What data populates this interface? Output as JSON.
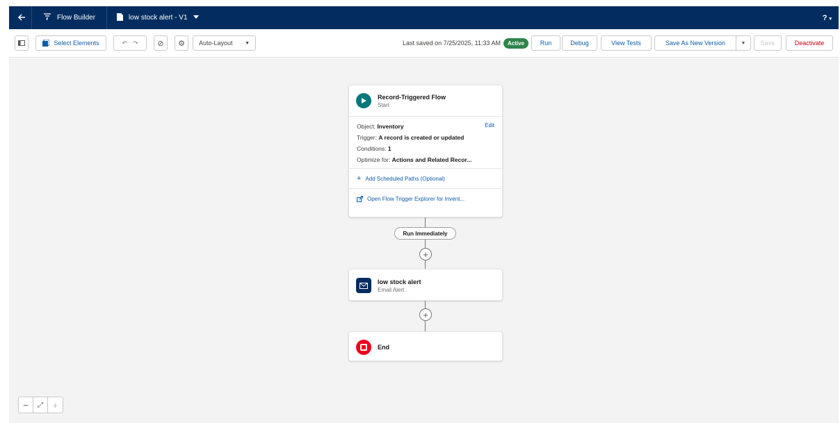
{
  "topbar": {
    "app_name": "Flow Builder",
    "file_name": "low stock alert - V1",
    "help_label": "?"
  },
  "toolbar": {
    "select_elements": "Select Elements",
    "layout_select": "Auto-Layout",
    "last_saved": "Last saved on 7/25/2025, 11:33 AM",
    "status_badge": "Active",
    "run": "Run",
    "debug": "Debug",
    "view_tests": "View Tests",
    "save_as_new_version": "Save As New Version",
    "save": "Save",
    "deactivate": "Deactivate"
  },
  "start_node": {
    "title": "Record-Triggered Flow",
    "subtitle": "Start",
    "edit": "Edit",
    "object_label": "Object:",
    "object_value": "Inventory",
    "trigger_label": "Trigger:",
    "trigger_value": "A record is created or updated",
    "conditions_label": "Conditions:",
    "conditions_value": "1",
    "optimize_label": "Optimize for:",
    "optimize_value": "Actions and Related Recor...",
    "add_scheduled_paths": "Add Scheduled Paths (Optional)",
    "open_trigger_explorer": "Open Flow Trigger Explorer for Invent..."
  },
  "path_label": "Run Immediately",
  "email_node": {
    "title": "low stock alert",
    "subtitle": "Email Alert"
  },
  "end_node": {
    "title": "End"
  },
  "colors": {
    "nav_bg": "#032d60",
    "canvas_bg": "#f3f3f3",
    "start_icon": "#03777a",
    "email_icon": "#032d60",
    "end_icon": "#ea001e",
    "active_badge": "#2e844a"
  }
}
